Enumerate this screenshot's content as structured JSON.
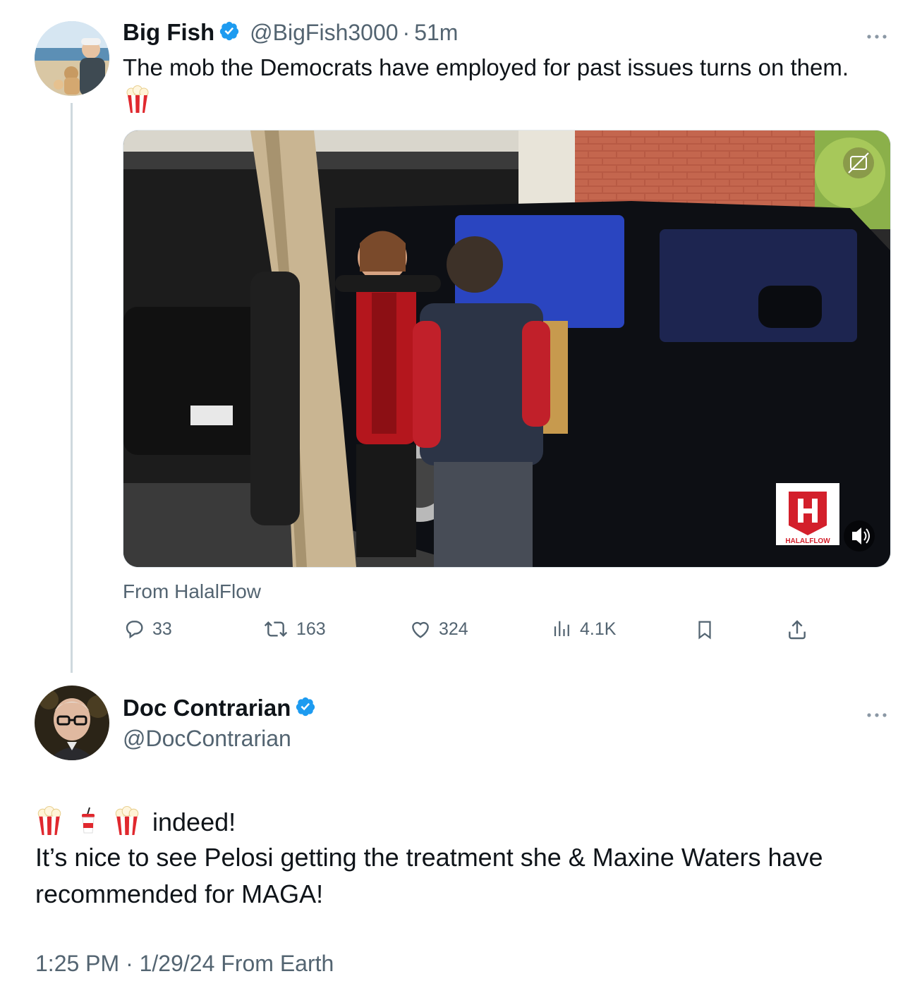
{
  "tweet1": {
    "author_name": "Big Fish",
    "handle": "@BigFish3000",
    "separator": "·",
    "time": "51m",
    "text": "The mob the Democrats have employed for past issues turns on them.",
    "emoji": "popcorn-icon",
    "media_source": "From HalalFlow",
    "media_overlay_badge": "HALALFLOW",
    "stats": {
      "replies": "33",
      "reposts": "163",
      "likes": "324",
      "views": "4.1K"
    }
  },
  "tweet2": {
    "author_name": "Doc Contrarian",
    "handle": "@DocContrarian",
    "line1_text": "indeed!",
    "line1_emojis": [
      "popcorn-icon",
      "soda-cup-icon",
      "popcorn-icon"
    ],
    "line2": "It’s nice to see Pelosi getting the treatment she & Maxine Waters have",
    "line3": "recommended for MAGA!",
    "timestamp": "1:25 PM · 1/29/24 From Earth"
  },
  "colors": {
    "text": "#0f1419",
    "secondary": "#536471",
    "verified": "#1d9bf0",
    "thread_line": "#cfd9de"
  }
}
